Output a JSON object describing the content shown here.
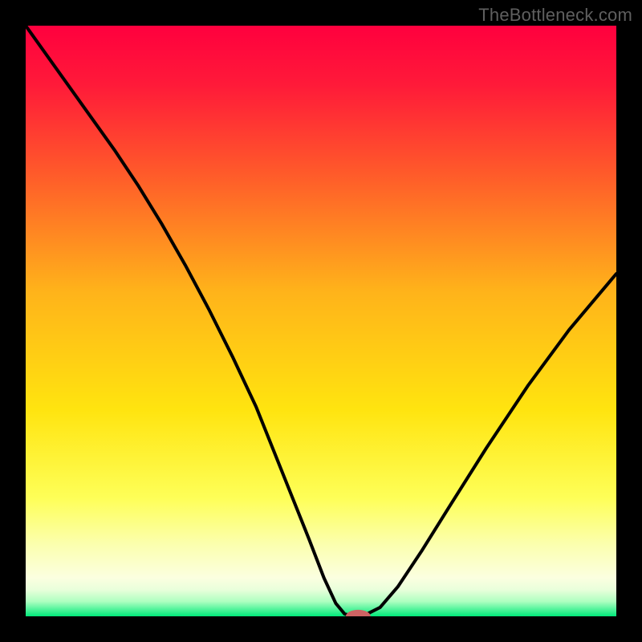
{
  "attribution": "TheBottleneck.com",
  "colors": {
    "frame": "#000000",
    "curve": "#000000",
    "marker_fill": "#ce6363",
    "gradient_stops": [
      {
        "offset": 0.0,
        "color": "#ff003e"
      },
      {
        "offset": 0.1,
        "color": "#ff1a39"
      },
      {
        "offset": 0.25,
        "color": "#ff5a2a"
      },
      {
        "offset": 0.45,
        "color": "#ffb31a"
      },
      {
        "offset": 0.65,
        "color": "#ffe40f"
      },
      {
        "offset": 0.8,
        "color": "#feff58"
      },
      {
        "offset": 0.88,
        "color": "#fbffb0"
      },
      {
        "offset": 0.935,
        "color": "#fbffe0"
      },
      {
        "offset": 0.955,
        "color": "#e9ffdb"
      },
      {
        "offset": 0.975,
        "color": "#adffc0"
      },
      {
        "offset": 1.0,
        "color": "#00e97a"
      }
    ]
  },
  "chart_data": {
    "type": "line",
    "title": "",
    "xlabel": "",
    "ylabel": "",
    "xlim": [
      0,
      100
    ],
    "ylim": [
      0,
      100
    ],
    "grid": false,
    "legend": false,
    "x": [
      0,
      5,
      10,
      15,
      19,
      23,
      27,
      31,
      35,
      39,
      42,
      45,
      48,
      50.5,
      52.5,
      54,
      55.5,
      57,
      60,
      63,
      67,
      72,
      78,
      85,
      92,
      100
    ],
    "values": [
      100,
      93,
      86,
      79,
      73,
      66.5,
      59.5,
      52,
      44,
      35.5,
      28,
      20.5,
      13,
      6.5,
      2.2,
      0.4,
      0,
      0,
      1.5,
      5,
      11,
      19,
      28.5,
      39,
      48.5,
      58
    ],
    "marker": {
      "x": 56.3,
      "y": 0,
      "rx": 2.1,
      "ry": 1.1
    }
  }
}
